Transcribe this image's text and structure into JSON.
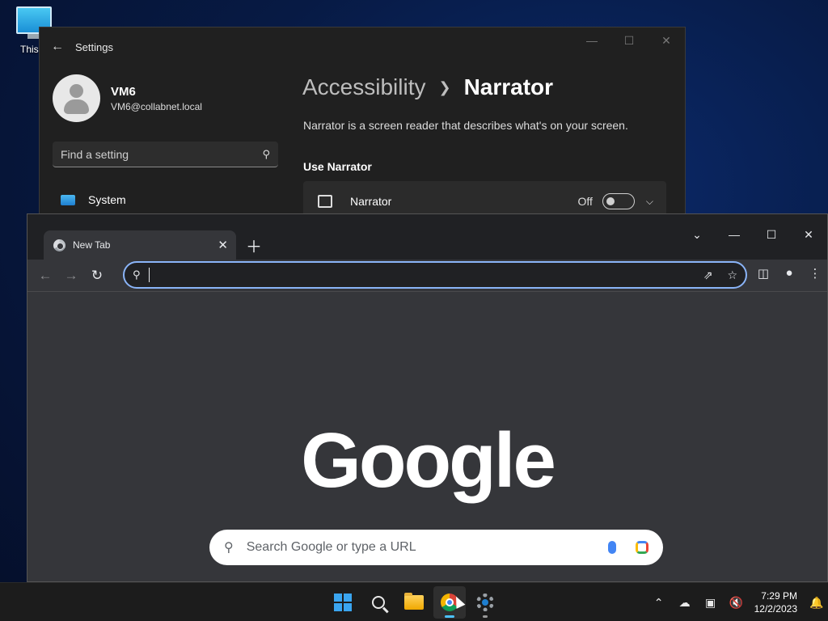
{
  "desktop": {
    "icon_label": "This P"
  },
  "settings": {
    "title": "Settings",
    "profile": {
      "name": "VM6",
      "email": "VM6@collabnet.local"
    },
    "search_placeholder": "Find a setting",
    "nav": [
      {
        "label": "System"
      }
    ],
    "breadcrumb": {
      "parent": "Accessibility",
      "current": "Narrator"
    },
    "description": "Narrator is a screen reader that describes what's on your screen.",
    "section_header": "Use Narrator",
    "narrator_row": {
      "label": "Narrator",
      "state": "Off"
    }
  },
  "chrome": {
    "tab_title": "New Tab",
    "omnibox_value": "",
    "google_logo": "Google",
    "search_placeholder": "Search Google or type a URL"
  },
  "taskbar": {
    "time": "7:29 PM",
    "date": "12/2/2023",
    "apps": [
      "start-icon",
      "search-icon",
      "file-explorer-icon",
      "chrome-icon",
      "settings-icon"
    ]
  },
  "colors": {
    "accent_blue": "#8ab4f8",
    "taskbar_indicator": "#4cc2ff",
    "windows_blue": "#3aa5f0"
  }
}
